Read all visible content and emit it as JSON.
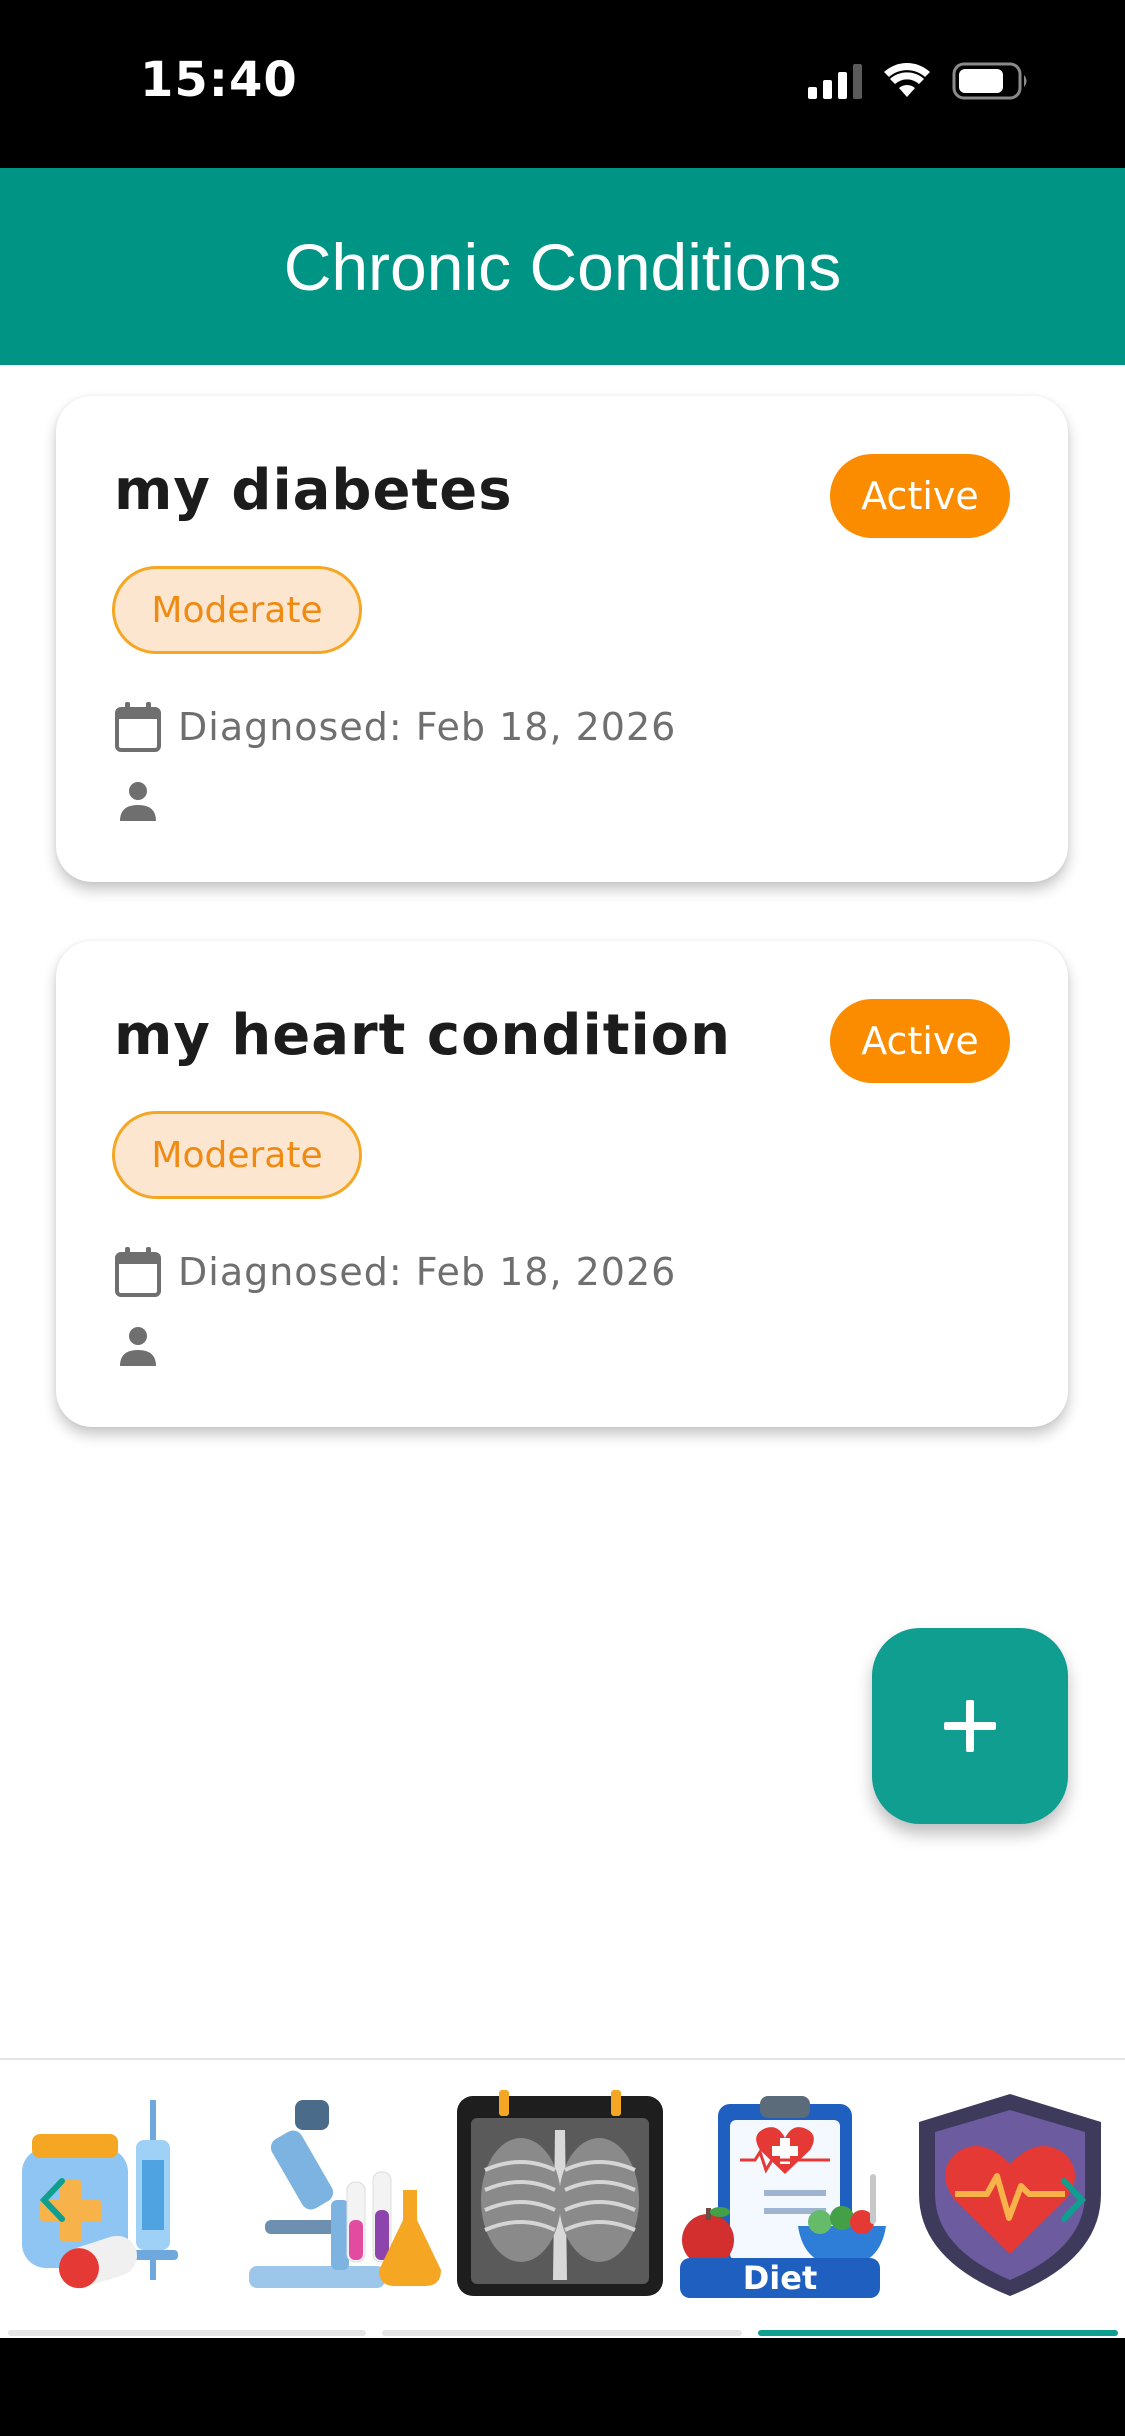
{
  "status_bar": {
    "time": "15:40"
  },
  "header": {
    "title": "Chronic Conditions"
  },
  "conditions": [
    {
      "name": "my diabetes",
      "status": "Active",
      "severity": "Moderate",
      "diagnosed": "Diagnosed: Feb 18, 2026"
    },
    {
      "name": "my heart condition",
      "status": "Active",
      "severity": "Moderate",
      "diagnosed": "Diagnosed: Feb 18, 2026"
    }
  ],
  "colors": {
    "primary": "#009485",
    "accent_orange": "#FB8C00",
    "severity_bg": "#FDE6CF",
    "severity_border": "#F5A623"
  },
  "fab": {
    "icon": "plus-icon"
  },
  "carousel": {
    "items": [
      {
        "icon": "medicine-icon"
      },
      {
        "icon": "microscope-lab-icon"
      },
      {
        "icon": "xray-icon"
      },
      {
        "icon": "diet-icon",
        "label": "Diet"
      },
      {
        "icon": "heart-shield-icon"
      }
    ]
  }
}
